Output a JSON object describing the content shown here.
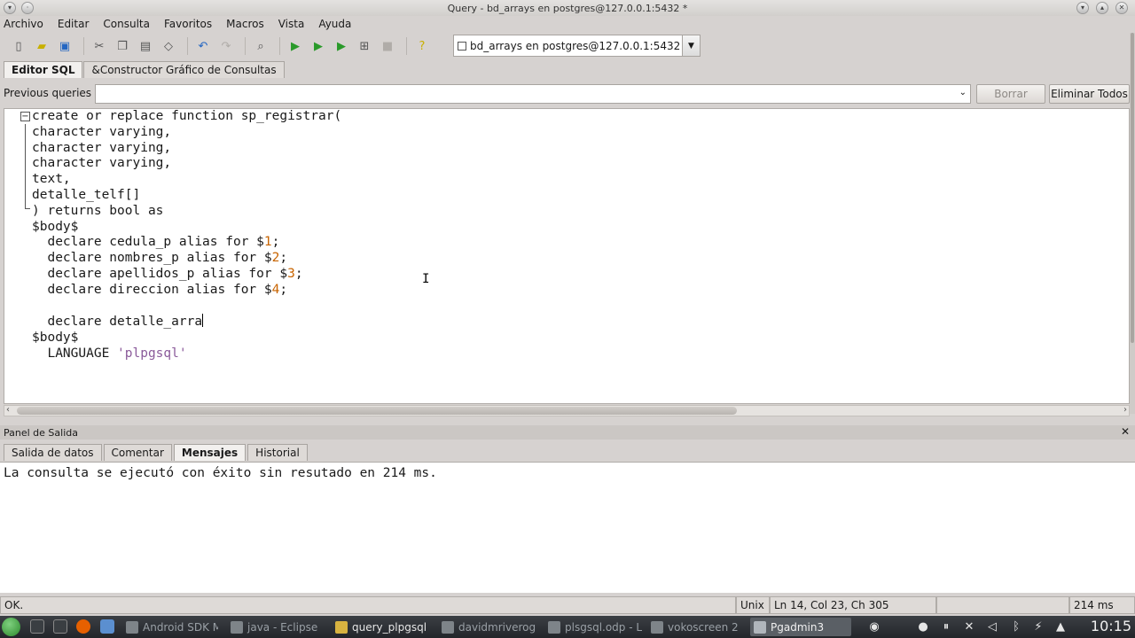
{
  "window": {
    "title": "Query - bd_arrays en postgres@127.0.0.1:5432 *"
  },
  "menu": [
    "Archivo",
    "Editar",
    "Consulta",
    "Favoritos",
    "Macros",
    "Vista",
    "Ayuda"
  ],
  "toolbar": {
    "icons": [
      "new-file-icon",
      "open-folder-icon",
      "save-icon",
      "cut-icon",
      "copy-icon",
      "paste-icon",
      "clear-icon",
      "undo-icon",
      "redo-icon",
      "find-icon",
      "execute-icon",
      "execute-pgscript-icon",
      "execute-to-file-icon",
      "explain-icon",
      "cancel-icon",
      "help-icon"
    ],
    "connection": "bd_arrays en postgres@127.0.0.1:5432"
  },
  "editor_tabs": [
    "Editor SQL",
    "&Constructor Gráfico de Consultas"
  ],
  "previous_queries": {
    "label": "Previous queries",
    "value": "",
    "delete_label": "Borrar",
    "delete_all_label": "Eliminar Todos"
  },
  "code_lines": [
    "create or replace function sp_registrar(",
    "character varying,",
    "character varying,",
    "character varying,",
    "text,",
    "detalle_telf[]",
    ") returns bool as",
    "$body$",
    "  declare cedula_p alias for $1;",
    "  declare nombres_p alias for $2;",
    "  declare apellidos_p alias for $3;",
    "  declare direccion alias for $4;",
    "",
    "  declare detalle_arra",
    "$body$",
    "  LANGUAGE 'plpgsql'"
  ],
  "output_panel": {
    "title": "Panel de Salida",
    "tabs": [
      "Salida de datos",
      "Comentar",
      "Mensajes",
      "Historial"
    ],
    "active_tab": "Mensajes",
    "message": "La consulta se ejecutó con éxito sin resutado en 214 ms."
  },
  "status": {
    "state": "OK.",
    "line_ending": "Unix",
    "position": "Ln 14, Col 23, Ch 305",
    "time": "214 ms"
  },
  "taskbar": {
    "tasks": [
      "Android SDK M",
      "java - Eclipse",
      "query_plpgsql",
      "davidmriverog",
      "plsgsql.odp - L",
      "vokoscreen 2",
      "Pgadmin3"
    ],
    "clock": "10:15"
  },
  "colors": {
    "number": "#c86400",
    "string": "#8a5a9a",
    "taskbar": "#2b2e32"
  }
}
